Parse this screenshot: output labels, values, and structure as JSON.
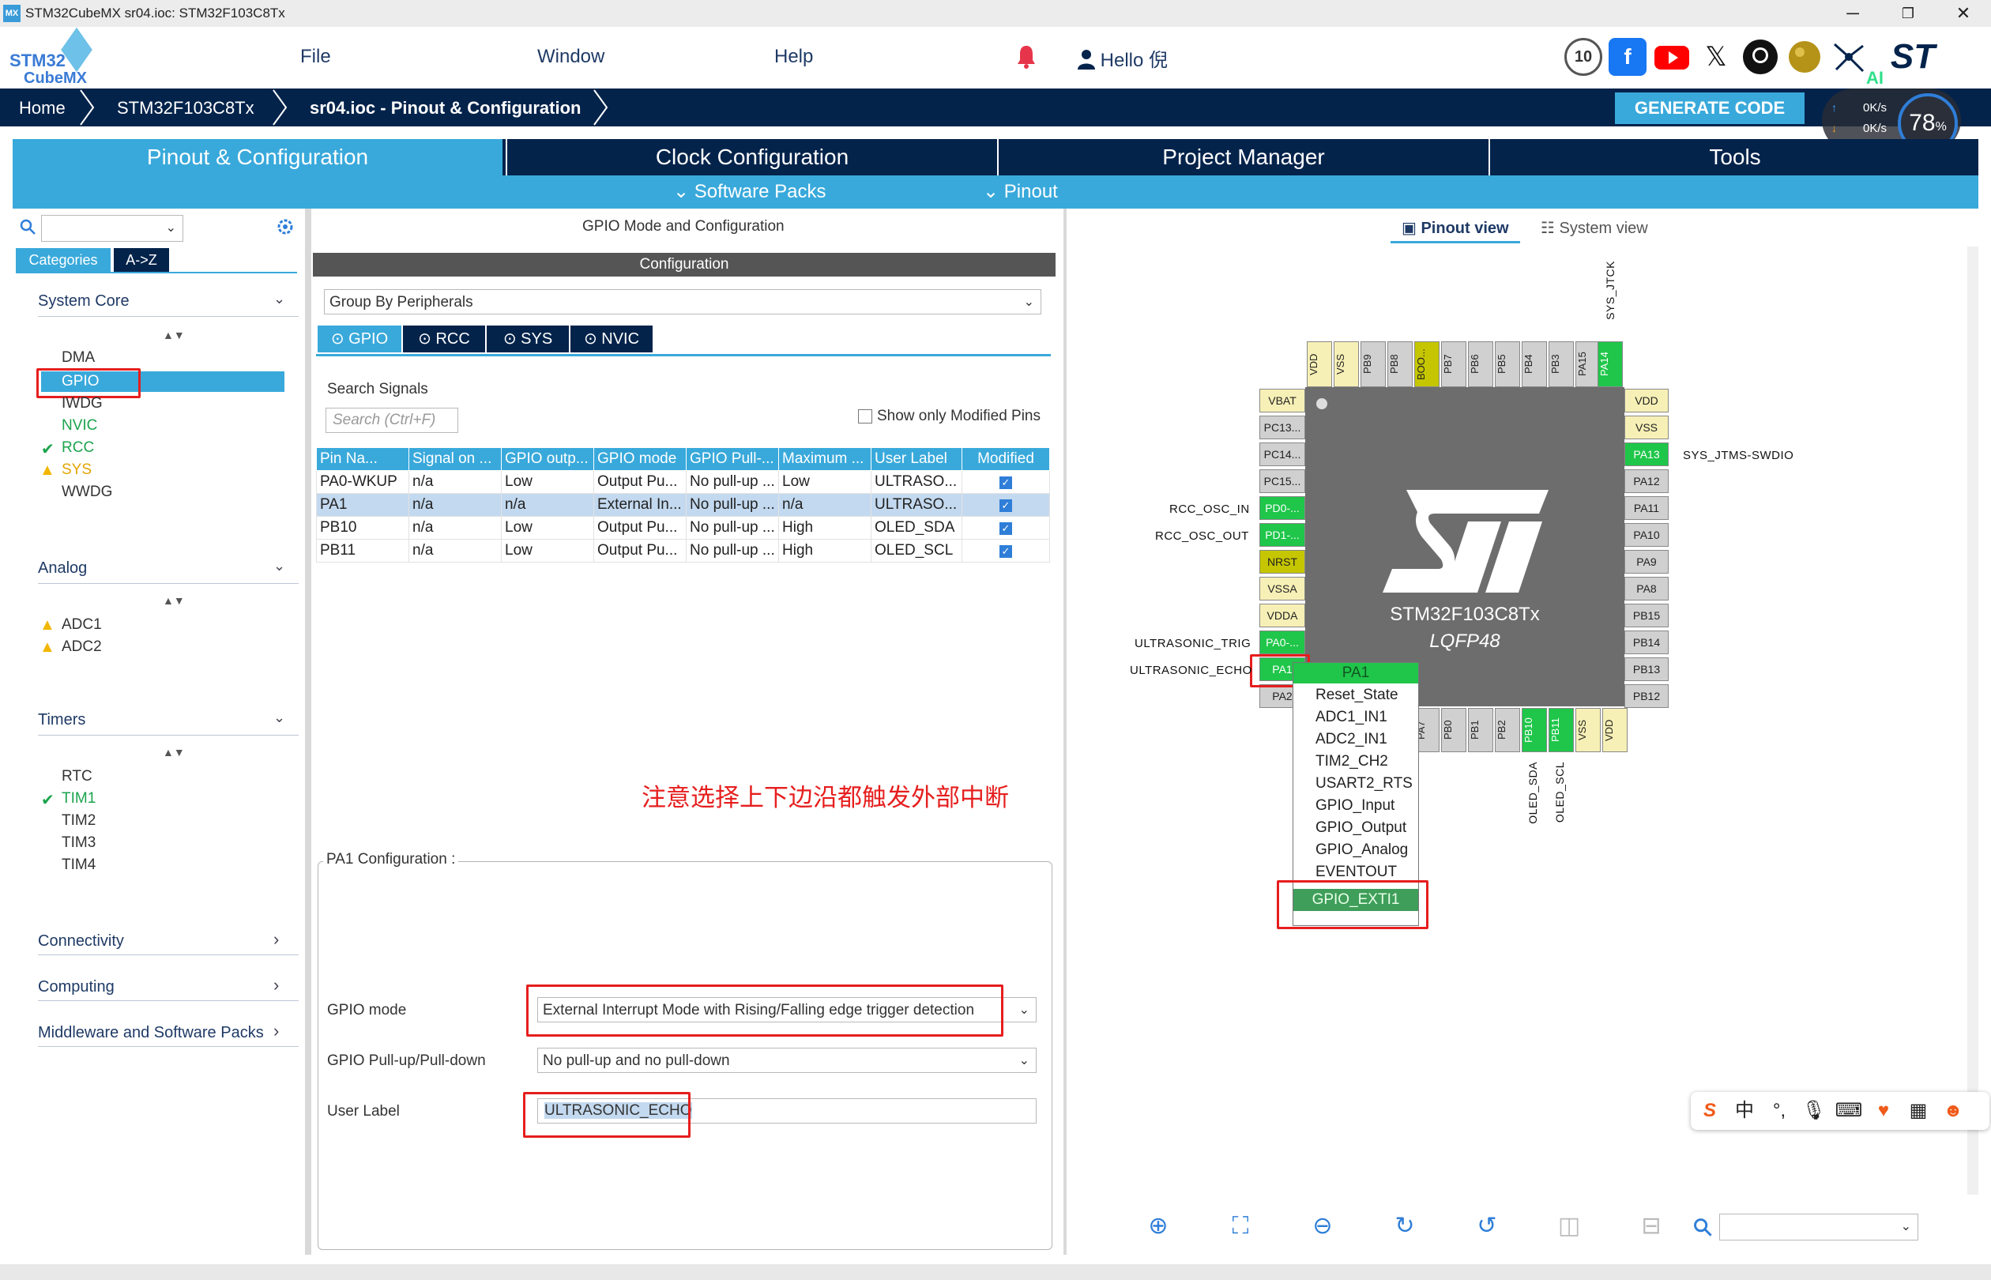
{
  "window": {
    "title": "STM32CubeMX sr04.ioc: STM32F103C8Tx",
    "app_icon": "MX",
    "minimize": "─",
    "maximize": "❐",
    "close": "✕"
  },
  "logo": {
    "line1": "STM32",
    "line2": "CubeMX"
  },
  "menu": {
    "file": "File",
    "window": "Window",
    "help": "Help",
    "user": "Hello 倪"
  },
  "socials": [
    "10-anniversary-icon",
    "facebook-icon",
    "youtube-icon",
    "x-icon",
    "github-icon",
    "wiki-icon",
    "network-icon",
    "st-logo-icon"
  ],
  "breadcrumb": {
    "home": "Home",
    "mcu": "STM32F103C8Tx",
    "current": "sr04.ioc - Pinout & Configuration"
  },
  "generate_code": "GENERATE CODE",
  "speed": {
    "up": "0K/s",
    "down": "0K/s",
    "percent": "78",
    "percent_sign": "%",
    "ai": "AI"
  },
  "tabs": {
    "pinout": "Pinout & Configuration",
    "clock": "Clock Configuration",
    "project": "Project Manager",
    "tools": "Tools"
  },
  "subtabs": {
    "software_packs": "Software Packs",
    "pinout": "Pinout"
  },
  "left": {
    "categories_tab": "Categories",
    "az_tab": "A->Z",
    "system_core": {
      "title": "System Core",
      "items": [
        "DMA",
        "GPIO",
        "IWDG",
        "NVIC",
        "RCC",
        "SYS",
        "WWDG"
      ]
    },
    "analog": {
      "title": "Analog",
      "items": [
        "ADC1",
        "ADC2"
      ]
    },
    "timers": {
      "title": "Timers",
      "items": [
        "RTC",
        "TIM1",
        "TIM2",
        "TIM3",
        "TIM4"
      ]
    },
    "connectivity": "Connectivity",
    "computing": "Computing",
    "middleware": "Middleware and Software Packs"
  },
  "middle": {
    "header": "GPIO Mode and Configuration",
    "config_bar": "Configuration",
    "group_by": "Group By Peripherals",
    "peripheral_tabs": [
      "GPIO",
      "RCC",
      "SYS",
      "NVIC"
    ],
    "search_label": "Search Signals",
    "search_placeholder": "Search (Ctrl+F)",
    "show_modified": "Show only Modified Pins",
    "table": {
      "headers": [
        "Pin Na...",
        "Signal on ...",
        "GPIO outp...",
        "GPIO mode",
        "GPIO Pull-...",
        "Maximum ...",
        "User Label",
        "Modified"
      ],
      "rows": [
        [
          "PA0-WKUP",
          "n/a",
          "Low",
          "Output Pu...",
          "No pull-up ...",
          "Low",
          "ULTRASO...",
          "✓"
        ],
        [
          "PA1",
          "n/a",
          "n/a",
          "External In...",
          "No pull-up ...",
          "n/a",
          "ULTRASO...",
          "✓"
        ],
        [
          "PB10",
          "n/a",
          "Low",
          "Output Pu...",
          "No pull-up ...",
          "High",
          "OLED_SDA",
          "✓"
        ],
        [
          "PB11",
          "n/a",
          "Low",
          "Output Pu...",
          "No pull-up ...",
          "High",
          "OLED_SCL",
          "✓"
        ]
      ]
    },
    "pa1_config_title": "PA1 Configuration :",
    "note": "注意选择上下边沿都触发外部中断",
    "gpio_mode_label": "GPIO mode",
    "gpio_mode_value": "External Interrupt Mode with Rising/Falling edge trigger detection",
    "pull_label": "GPIO Pull-up/Pull-down",
    "pull_value": "No pull-up and no pull-down",
    "user_label_label": "User Label",
    "user_label_value": "ULTRASONIC_ECHO"
  },
  "right": {
    "pinout_view": "Pinout view",
    "system_view": "System view",
    "chip_name": "STM32F103C8Tx",
    "package": "LQFP48",
    "top_pins": [
      "VDD",
      "VSS",
      "PB9",
      "PB8",
      "BOO...",
      "PB7",
      "PB6",
      "PB5",
      "PB4",
      "PB3",
      "PA15",
      "PA14"
    ],
    "left_pins": [
      "VBAT",
      "PC13...",
      "PC14...",
      "PC15...",
      "PD0-...",
      "PD1-...",
      "NRST",
      "VSSA",
      "VDDA",
      "PA0-...",
      "PA1",
      "PA2"
    ],
    "right_pins": [
      "VDD",
      "VSS",
      "PA13",
      "PA12",
      "PA11",
      "PA10",
      "PA9",
      "PA8",
      "PB15",
      "PB14",
      "PB13",
      "PB12"
    ],
    "bottom_pins": [
      "PA7",
      "PB0",
      "PB1",
      "PB2",
      "PB10",
      "PB11",
      "VSS",
      "VDD"
    ],
    "signals": {
      "sys_jtck": "SYS_JTCK",
      "sys_jtms": "SYS_JTMS-SWDIO",
      "rcc_in": "RCC_OSC_IN",
      "rcc_out": "RCC_OSC_OUT",
      "trig": "ULTRASONIC_TRIG",
      "echo": "ULTRASONIC_ECHO",
      "sda": "OLED_SDA",
      "scl": "OLED_SCL"
    },
    "popup": {
      "title": "PA1",
      "items": [
        "Reset_State",
        "ADC1_IN1",
        "ADC2_IN1",
        "TIM2_CH2",
        "USART2_RTS",
        "GPIO_Input",
        "GPIO_Output",
        "GPIO_Analog",
        "EVENTOUT"
      ],
      "selected": "GPIO_EXTI1"
    }
  },
  "ime": {
    "sogou": "S",
    "lang": "中"
  },
  "colors": {
    "navy": "#03234b",
    "accent": "#39a9db",
    "pin_green": "#1fc64a",
    "red_box": "#e61e1e"
  }
}
